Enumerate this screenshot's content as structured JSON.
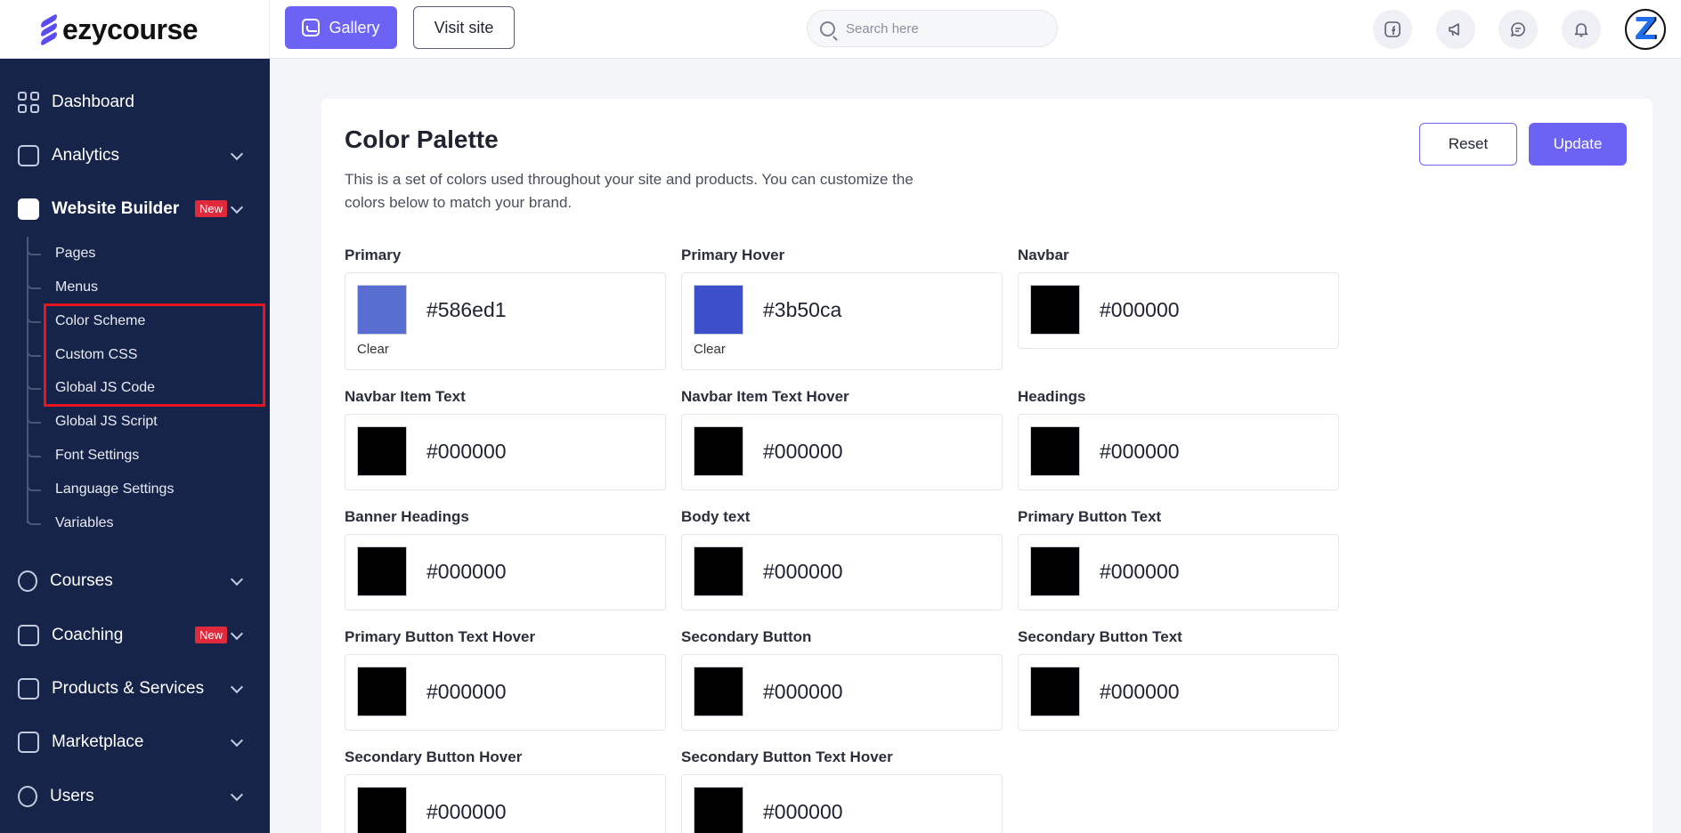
{
  "brand": {
    "name": "ezycourse"
  },
  "topbar": {
    "gallery_label": "Gallery",
    "visit_label": "Visit site",
    "search_placeholder": "Search here"
  },
  "sidebar": {
    "items": [
      {
        "label": "Dashboard"
      },
      {
        "label": "Analytics"
      },
      {
        "label": "Website Builder",
        "badge": "New"
      },
      {
        "label": "Courses"
      },
      {
        "label": "Coaching",
        "badge": "New"
      },
      {
        "label": "Products & Services"
      },
      {
        "label": "Marketplace"
      },
      {
        "label": "Users"
      }
    ],
    "sub_items": [
      {
        "label": "Pages"
      },
      {
        "label": "Menus"
      },
      {
        "label": "Color Scheme"
      },
      {
        "label": "Custom CSS"
      },
      {
        "label": "Global JS Code"
      },
      {
        "label": "Global JS Script"
      },
      {
        "label": "Font Settings"
      },
      {
        "label": "Language Settings"
      },
      {
        "label": "Variables"
      }
    ]
  },
  "main": {
    "title": "Color Palette",
    "description": "This is a set of colors used throughout your site and products. You can customize the colors below to match your brand.",
    "reset_label": "Reset",
    "update_label": "Update",
    "fields": [
      {
        "label": "Primary",
        "value": "#586ed1",
        "color": "#586ed1",
        "clear": "Clear"
      },
      {
        "label": "Primary Hover",
        "value": "#3b50ca",
        "color": "#3b50ca",
        "clear": "Clear"
      },
      {
        "label": "Navbar",
        "value": "#000000",
        "color": "#000000"
      },
      {
        "label": "Navbar Item Text",
        "value": "#000000",
        "color": "#000000"
      },
      {
        "label": "Navbar Item Text Hover",
        "value": "#000000",
        "color": "#000000"
      },
      {
        "label": "Headings",
        "value": "#000000",
        "color": "#000000"
      },
      {
        "label": "Banner Headings",
        "value": "#000000",
        "color": "#000000"
      },
      {
        "label": "Body text",
        "value": "#000000",
        "color": "#000000"
      },
      {
        "label": "Primary Button Text",
        "value": "#000000",
        "color": "#000000"
      },
      {
        "label": "Primary Button Text Hover",
        "value": "#000000",
        "color": "#000000"
      },
      {
        "label": "Secondary Button",
        "value": "#000000",
        "color": "#000000"
      },
      {
        "label": "Secondary Button Text",
        "value": "#000000",
        "color": "#000000"
      },
      {
        "label": "Secondary Button Hover",
        "value": "#000000",
        "color": "#000000"
      },
      {
        "label": "Secondary Button Text Hover",
        "value": "#000000",
        "color": "#000000"
      }
    ]
  },
  "colors": {
    "accent": "#6c63f5",
    "sidebar_bg": "#162449",
    "highlight": "#e8141f",
    "badge": "#e0293b"
  }
}
